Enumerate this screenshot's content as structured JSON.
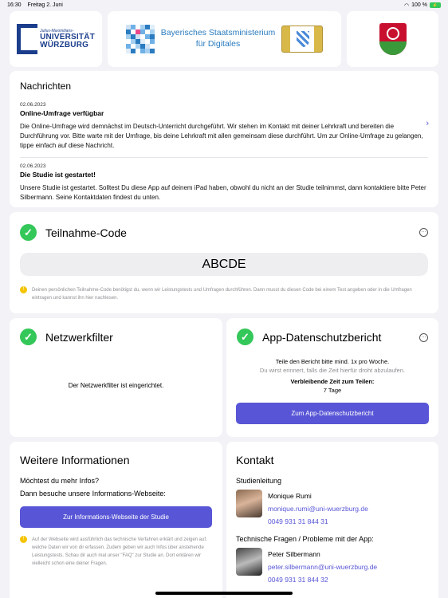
{
  "status_bar": {
    "time": "16:30",
    "date": "Freitag 2. Juni",
    "battery": "100 %"
  },
  "logos": {
    "university": {
      "line1": "Julius-Maximilians-",
      "line2": "UNIVERSITÄT",
      "line3": "WÜRZBURG"
    },
    "ministry": {
      "line1": "Bayerisches Staatsministerium",
      "line2": "für Digitales"
    }
  },
  "news": {
    "title": "Nachrichten",
    "items": [
      {
        "date": "02.06.2023",
        "headline": "Online-Umfrage verfügbar",
        "body": "Die Online-Umfrage wird demnächst im Deutsch-Unterricht durchgeführt. Wir stehen im Kontakt mit deiner Lehrkraft und bereiten die Durchführung vor. Bitte warte mit der Umfrage, bis deine Lehrkraft mit allen gemeinsam diese durchführt. Um zur Online-Umfrage zu gelangen, tippe einfach auf diese Nachricht."
      },
      {
        "date": "02.06.2023",
        "headline": "Die Studie ist gestartet!",
        "body": "Unsere Studie ist gestartet. Solltest Du diese App auf deinem iPad haben, obwohl du nicht an der Studie teilnimmst, dann kontaktiere bitte Peter Silbermann. Seine Kontaktdaten findest du unten."
      }
    ]
  },
  "participation": {
    "title": "Teilnahme-Code",
    "code": "ABCDE",
    "hint": "Deinen persönlichen Teilnahme-Code benötigst du, wenn wir Leistungstests und Umfragen durchführen. Dann musst du diesen Code bei einem Test angeben oder in die Umfragen eintragen und kannst ihn hier nachlesen."
  },
  "network": {
    "title": "Netzwerkfilter",
    "text": "Der Netzwerkfilter ist eingerichtet."
  },
  "privacy": {
    "title": "App-Datenschutzbericht",
    "line1": "Teile den Bericht bitte mind. 1x pro Woche.",
    "line2": "Du wirst erinnert, falls die Zeit hierfür droht abzulaufen.",
    "remaining_label": "Verbleibende Zeit zum Teilen:",
    "remaining_value": "7 Tage",
    "button": "Zum App-Datenschutzbericht"
  },
  "info": {
    "title": "Weitere Informationen",
    "line1": "Möchtest du mehr Infos?",
    "line2": "Dann besuche unsere Informations-Webseite:",
    "button": "Zur Informations-Webseite der Studie",
    "hint": "Auf der Webseite wird ausführlich das technische Verfahren erklärt und zeigen auf, welche Daten wir von dir erfassen. Zudem geben wir auch Infos über anstehende Leistungstests. Schau dir auch mal unser \"FAQ\" zur Studie an. Dort erklären wir vielleicht schon eine deiner Fragen."
  },
  "contact": {
    "title": "Kontakt",
    "group1": "Studienleitung",
    "person1": {
      "name": "Monique Rumi",
      "email": "monique.rumi@uni-wuerzburg.de",
      "phone": "0049 931 31 844 31"
    },
    "group2": "Technische Fragen / Probleme mit der App:",
    "person2": {
      "name": "Peter Silbermann",
      "email": "peter.silbermann@uni-wuerzburg.de",
      "phone": "0049 931 31 844 32"
    }
  },
  "colors": {
    "accent": "#5856d6",
    "success": "#34c759",
    "background": "#f2f2f7"
  }
}
